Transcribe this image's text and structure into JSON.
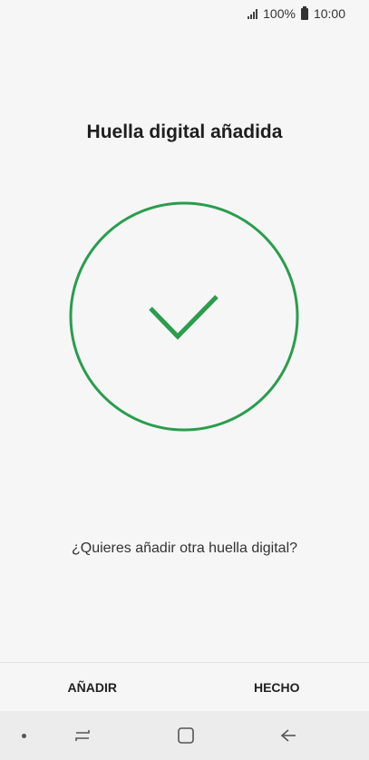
{
  "status_bar": {
    "battery_percent": "100%",
    "time": "10:00",
    "icons": [
      "signal-icon",
      "battery-icon"
    ]
  },
  "screen": {
    "title": "Huella digital añadida",
    "question": "¿Quieres añadir otra huella digital?",
    "success_icon": "check-circle-icon",
    "accent_color": "#2a9d4e"
  },
  "actions": {
    "add_label": "AÑADIR",
    "done_label": "HECHO"
  },
  "nav_bar": {
    "items": [
      "dot-icon",
      "recents-icon",
      "home-icon",
      "back-icon"
    ]
  }
}
